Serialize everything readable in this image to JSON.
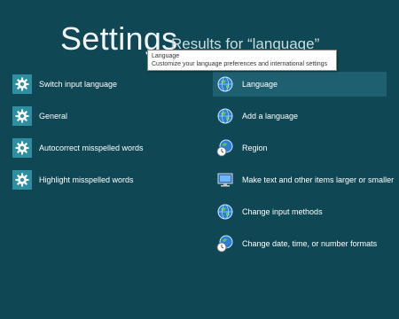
{
  "header": {
    "title": "Settings",
    "subtitle": "Results for “language”"
  },
  "tooltip": {
    "title": "Language",
    "description": "Customize your language preferences and international settings"
  },
  "left_results": [
    {
      "label": "Switch input language",
      "icon": "gear-icon"
    },
    {
      "label": "General",
      "icon": "gear-icon"
    },
    {
      "label": "Autocorrect misspelled words",
      "icon": "gear-icon"
    },
    {
      "label": "Highlight misspelled words",
      "icon": "gear-icon"
    }
  ],
  "right_results": [
    {
      "label": "Language",
      "icon": "globe-icon",
      "selected": true
    },
    {
      "label": "Add a language",
      "icon": "globe-icon"
    },
    {
      "label": "Region",
      "icon": "globe-clock-icon"
    },
    {
      "label": "Make text and other items larger or smaller",
      "icon": "monitor-icon"
    },
    {
      "label": "Change input methods",
      "icon": "globe-icon"
    },
    {
      "label": "Change date, time, or number formats",
      "icon": "globe-clock-icon"
    }
  ],
  "colors": {
    "background": "#0f4854",
    "gear_tile": "#2f8fa0",
    "selected_row": "#1f6070"
  }
}
